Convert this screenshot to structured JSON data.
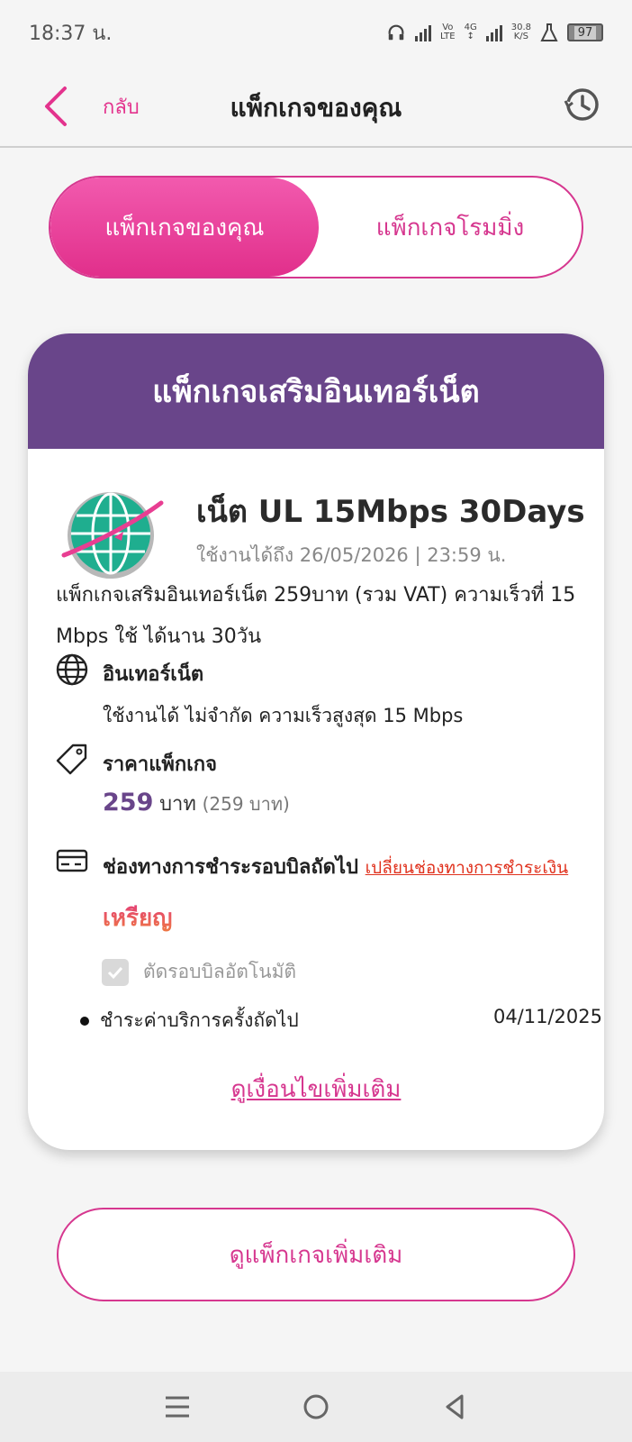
{
  "status_bar": {
    "time": "18:37 น.",
    "volte_top": "Vo",
    "volte_bottom": "LTE",
    "network": "4G",
    "speed_value": "30.8",
    "speed_unit": "K/S",
    "battery": "97"
  },
  "header": {
    "back_label": "กลับ",
    "title": "แพ็กเกจของคุณ"
  },
  "tabs": [
    {
      "label": "แพ็กเกจของคุณ",
      "active": true
    },
    {
      "label": "แพ็กเกจโรมมิ่ง",
      "active": false
    }
  ],
  "card": {
    "header": "แพ็กเกจเสริมอินเทอร์เน็ต",
    "package_name": "เน็ต UL 15Mbps 30Days",
    "validity": "ใช้งานได้ถึง 26/05/2026 | 23:59 น.",
    "description": "แพ็กเกจเสริมอินเทอร์เน็ต 259บาท (รวม VAT) ความเร็วที่ 15 Mbps ใช้ ได้นาน 30วัน",
    "internet": {
      "title": "อินเทอร์เน็ต",
      "detail": "ใช้งานได้ ไม่จำกัด ความเร็วสูงสุด 15 Mbps"
    },
    "price": {
      "title": "ราคาแพ็กเกจ",
      "amount": "259",
      "unit": "บาท",
      "sub": "(259 บาท)"
    },
    "payment": {
      "title": "ช่องทางการชำระรอบบิลถัดไป",
      "change_link": "เปลี่ยนช่องทางการชำระเงิน",
      "method": "เหรียญ",
      "autopay_label": "ตัดรอบบิลอัตโนมัติ",
      "autopay_checked": true,
      "next_payment_label": "ชำระค่าบริการครั้งถัดไป",
      "next_payment_date": "04/11/2025"
    },
    "more_conditions": "ดูเงื่อนไขเพิ่มเติม"
  },
  "more_packages_button": "ดูแพ็กเกจเพิ่มเติม",
  "colors": {
    "accent_pink": "#e3338d",
    "card_header_purple": "#69458a",
    "link_red": "#e0321e"
  },
  "icons": [
    "back-chevron-icon",
    "history-icon",
    "globe-icon",
    "tag-icon",
    "credit-card-icon",
    "check-icon",
    "menu-icon",
    "home-circle-icon",
    "back-triangle-icon"
  ]
}
